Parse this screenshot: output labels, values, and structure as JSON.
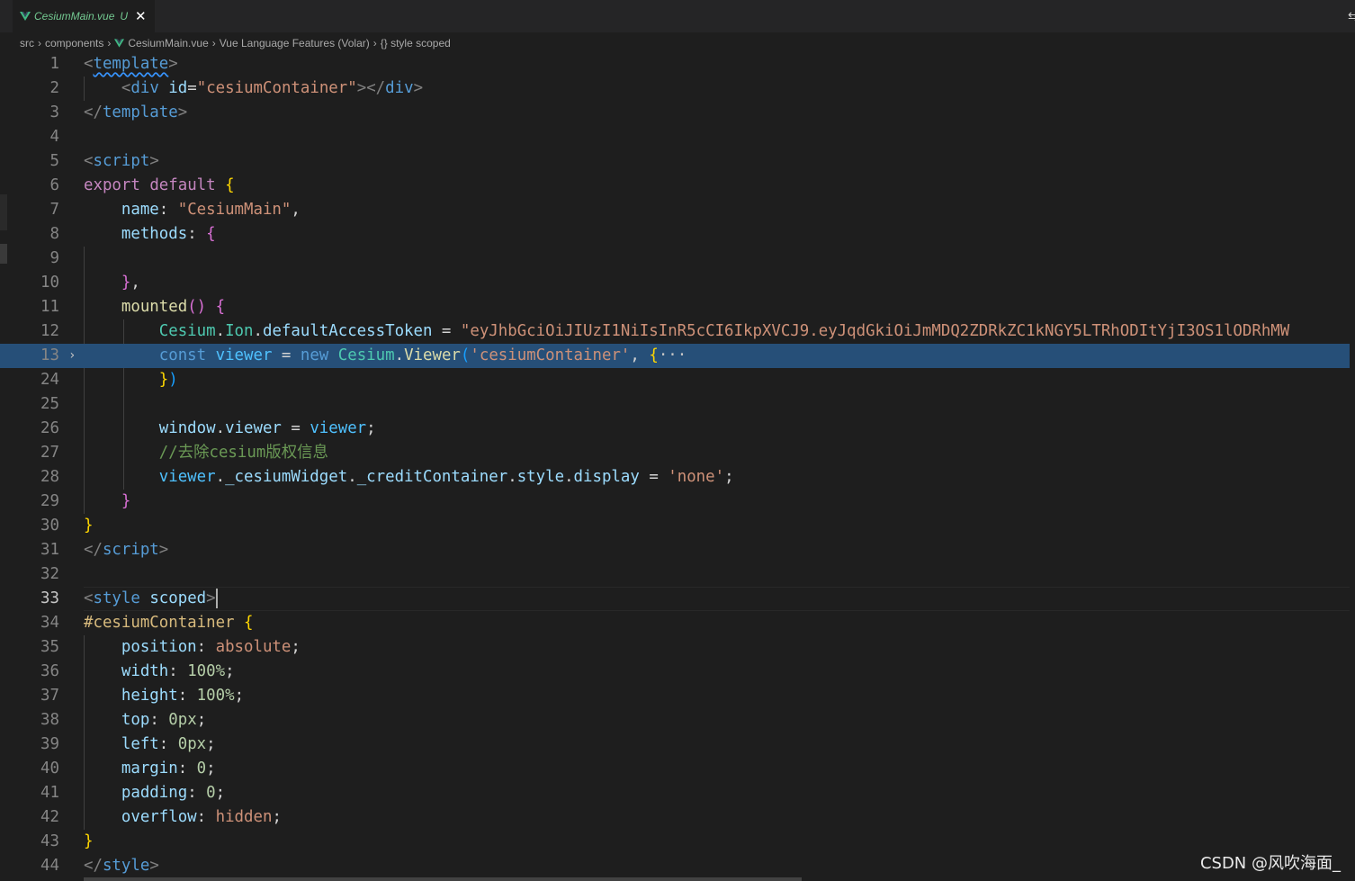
{
  "tab": {
    "filename": "CesiumMain.vue",
    "status": "U"
  },
  "breadcrumb": [
    "src",
    "components",
    "CesiumMain.vue",
    "Vue Language Features (Volar)",
    "{} style scoped"
  ],
  "editor": {
    "line_numbers": [
      "1",
      "2",
      "3",
      "4",
      "5",
      "6",
      "7",
      "8",
      "9",
      "10",
      "11",
      "12",
      "13",
      "24",
      "25",
      "26",
      "27",
      "28",
      "29",
      "30",
      "31",
      "32",
      "33",
      "34",
      "35",
      "36",
      "37",
      "38",
      "39",
      "40",
      "41",
      "42",
      "43",
      "44"
    ],
    "active_line": "33",
    "folded_line": "13",
    "long_token": "\"eyJhbGciOiJIUzI1NiIsInR5cCI6IkpXVCJ9.eyJqdGkiOiJmMDQ2ZDRkZC1kNGY5LTRhODItYjI3OS1lODRhMW",
    "comment": "//去除cesium版权信息",
    "fold_ellipsis": "···"
  },
  "watermark": "CSDN @风吹海面_"
}
